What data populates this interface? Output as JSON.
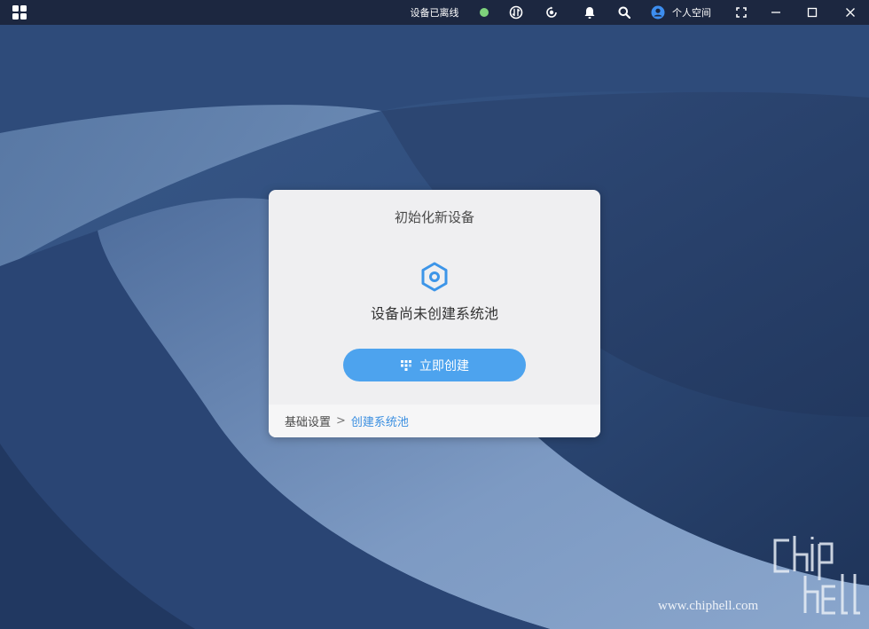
{
  "titlebar": {
    "status_text": "设备已离线",
    "status_color": "#7ed37c",
    "user_label": "个人空间",
    "icons": [
      "app-grid-icon",
      "sync-icon",
      "refresh-icon",
      "bell-icon",
      "search-icon",
      "user-icon",
      "fullscreen-icon",
      "minimize-icon",
      "maximize-icon",
      "close-icon"
    ]
  },
  "dialog": {
    "title": "初始化新设备",
    "empty_message": "设备尚未创建系统池",
    "create_button": "立即创建",
    "breadcrumb": {
      "home": "基础设置",
      "separator": ">",
      "current": "创建系统池"
    }
  },
  "watermark": {
    "brand": "chip hell",
    "url": "www.chiphell.com"
  },
  "colors": {
    "accent": "#4da3ee",
    "link": "#3b8fe0",
    "titlebar": "#1c2740",
    "background": "#2b4670"
  }
}
